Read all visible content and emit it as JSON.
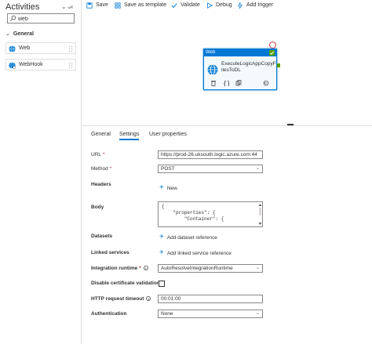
{
  "left_panel": {
    "title": "Activities",
    "collapse_icon": "chevron-double-down",
    "hide_icon": "chevron-double-left",
    "search": {
      "value": "web",
      "placeholder": ""
    },
    "group_label": "General",
    "items": [
      {
        "label": "Web",
        "icon": "globe-icon"
      },
      {
        "label": "WebHook",
        "icon": "webhook-icon"
      }
    ]
  },
  "toolbar": {
    "save": "Save",
    "save_as_template": "Save as template",
    "validate": "Validate",
    "debug": "Debug",
    "add_trigger": "Add trigger"
  },
  "canvas": {
    "node": {
      "type_label": "Web",
      "name": "ExecuteLogicAppCopyFilesToDL",
      "status": "success",
      "accent": "#0078d4"
    }
  },
  "props": {
    "tabs": [
      "General",
      "Settings",
      "User properties"
    ],
    "active_tab": "Settings",
    "fields": {
      "url_label": "URL",
      "url_value": "https://prod-26.uksouth.logic.azure.com:44",
      "method_label": "Method",
      "method_value": "POST",
      "headers_label": "Headers",
      "headers_add": "New",
      "body_label": "Body",
      "body_value": "{\n    \"properties\": {\n        \"Container\": {",
      "datasets_label": "Datasets",
      "datasets_add": "Add dataset reference",
      "linked_label": "Linked services",
      "linked_add": "Add linked service reference",
      "runtime_label": "Integration runtime",
      "runtime_value": "AutoResolveIntegrationRuntime",
      "cert_label": "Disable certificate validation",
      "cert_checked": false,
      "timeout_label": "HTTP request timeout",
      "timeout_value": "00:01:00",
      "auth_label": "Authentication",
      "auth_value": "None"
    }
  }
}
